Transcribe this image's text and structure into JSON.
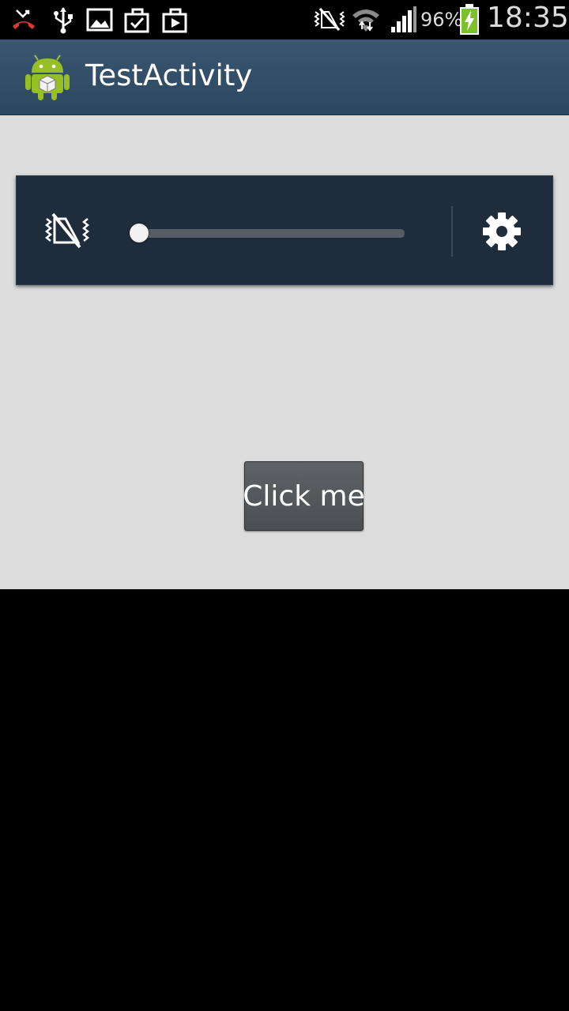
{
  "status_bar": {
    "battery_percent": "96%",
    "time": "18:35",
    "left_icons": [
      "missed-call-icon",
      "usb-icon",
      "image-icon",
      "briefcase-check-icon",
      "briefcase-play-icon"
    ],
    "right_icons": [
      "vibrate-icon",
      "wifi-icon",
      "signal-icon",
      "battery-charging-icon"
    ]
  },
  "action_bar": {
    "title": "TestActivity",
    "icon": "android-app-icon"
  },
  "volume_panel": {
    "mute_icon": "vibrate-mode-icon",
    "volume_level": 0,
    "settings_icon": "gear-icon"
  },
  "main": {
    "button_label": "Click me"
  },
  "colors": {
    "action_bar": "#34506a",
    "content_bg": "#dcdcdc",
    "panel_bg": "#1f2c3b",
    "button_bg": "#55595d"
  }
}
